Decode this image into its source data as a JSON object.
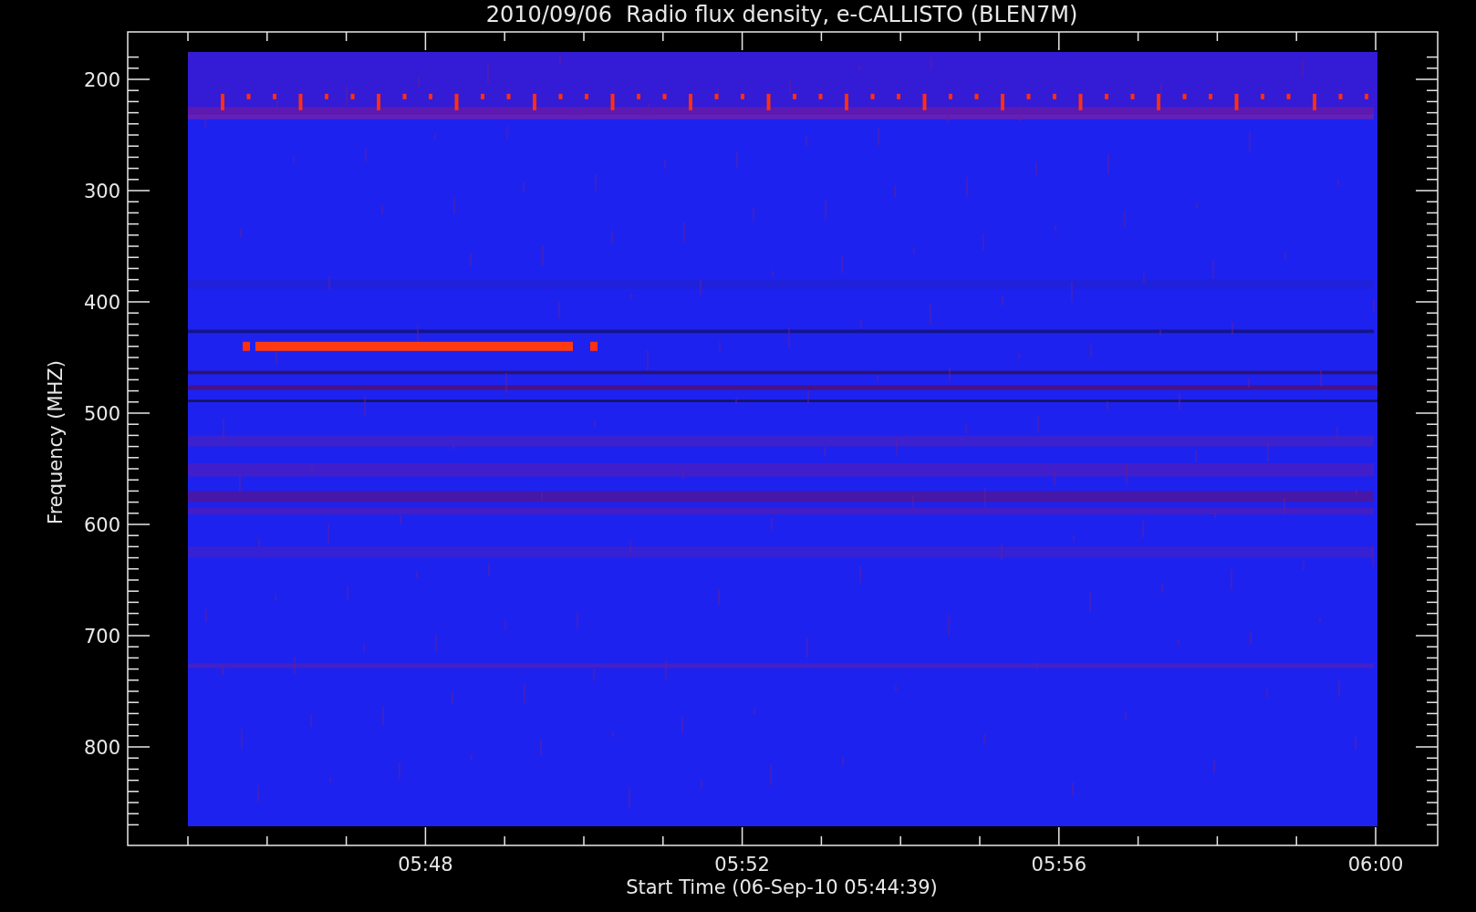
{
  "title": "2010/09/06  Radio flux density, e-CALLISTO (BLEN7M)",
  "ylabel": "Frequency (MHZ)",
  "xlabel": "Start Time (06-Sep-10 05:44:39)",
  "yticks": [
    "200",
    "300",
    "400",
    "500",
    "600",
    "700",
    "800"
  ],
  "xticks": [
    "05:48",
    "05:52",
    "05:56",
    "06:00"
  ]
}
